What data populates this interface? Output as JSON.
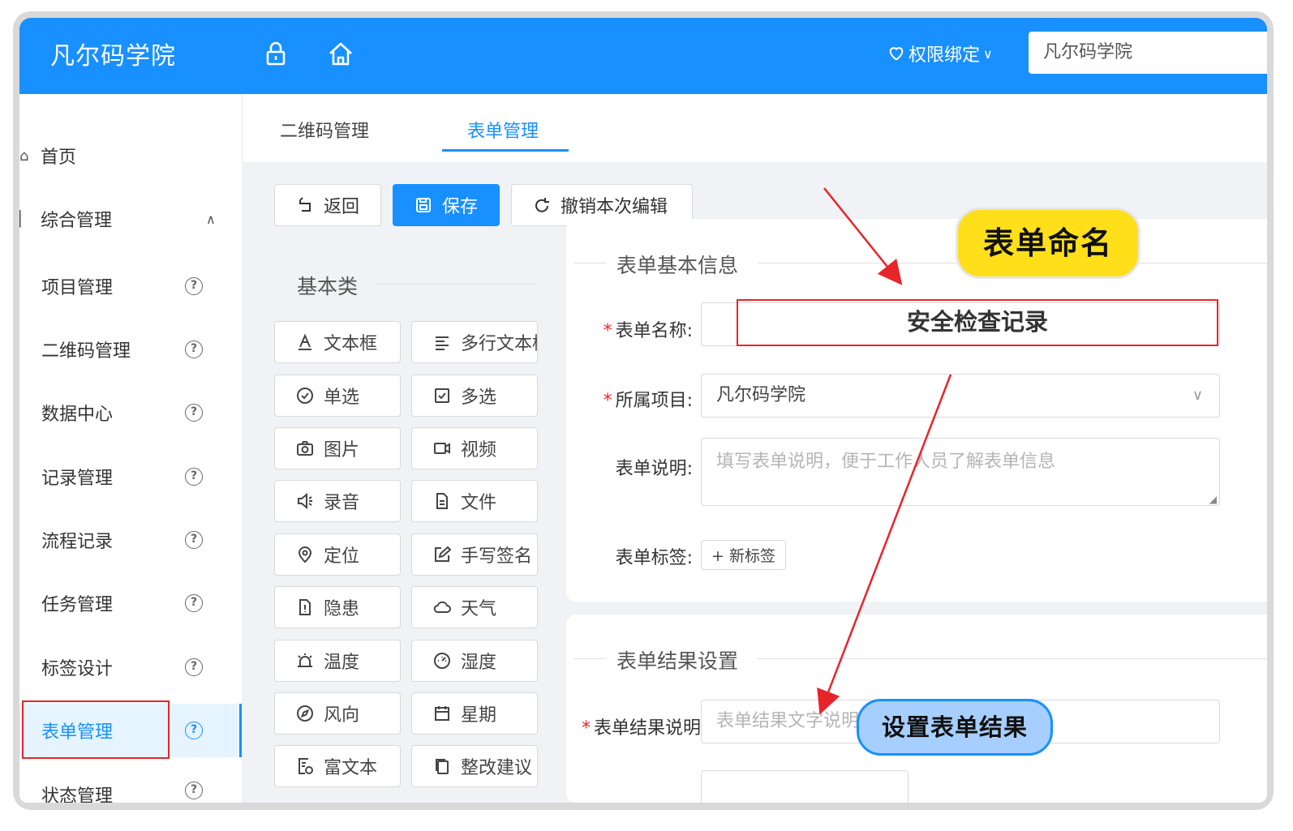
{
  "header": {
    "brand": "凡尔码学院",
    "permission": "权限绑定",
    "search_value": "凡尔码学院"
  },
  "sidebar": {
    "home": "首页",
    "group": "综合管理",
    "items": [
      "项目管理",
      "二维码管理",
      "数据中心",
      "记录管理",
      "流程记录",
      "任务管理",
      "标签设计",
      "表单管理",
      "状态管理"
    ],
    "active_index": 7
  },
  "tabs": [
    "二维码管理",
    "表单管理"
  ],
  "toolbar": {
    "back": "返回",
    "save": "保存",
    "undo": "撤销本次编辑"
  },
  "palette": {
    "section": "基本类",
    "components": [
      {
        "label": "文本框",
        "icon": "text-a-icon"
      },
      {
        "label": "多行文本框",
        "icon": "align-left-icon"
      },
      {
        "label": "单选",
        "icon": "radio-check-icon"
      },
      {
        "label": "多选",
        "icon": "checkbox-icon"
      },
      {
        "label": "图片",
        "icon": "camera-icon"
      },
      {
        "label": "视频",
        "icon": "video-icon"
      },
      {
        "label": "录音",
        "icon": "speaker-icon"
      },
      {
        "label": "文件",
        "icon": "file-icon"
      },
      {
        "label": "定位",
        "icon": "location-icon"
      },
      {
        "label": "手写签名",
        "icon": "edit-icon"
      },
      {
        "label": "隐患",
        "icon": "hazard-file-icon"
      },
      {
        "label": "天气",
        "icon": "cloud-icon"
      },
      {
        "label": "温度",
        "icon": "alarm-icon"
      },
      {
        "label": "湿度",
        "icon": "dashboard-icon"
      },
      {
        "label": "风向",
        "icon": "compass-icon"
      },
      {
        "label": "星期",
        "icon": "calendar-icon"
      },
      {
        "label": "富文本",
        "icon": "rich-text-icon"
      },
      {
        "label": "整改建议",
        "icon": "copy-icon"
      }
    ]
  },
  "form_basic": {
    "section": "表单基本信息",
    "name_label": "表单名称:",
    "name_value": "安全检查记录",
    "project_label": "所属项目:",
    "project_value": "凡尔码学院",
    "desc_label": "表单说明:",
    "desc_placeholder": "填写表单说明，便于工作人员了解表单信息",
    "tag_label": "表单标签:",
    "tag_button": "+ 新标签"
  },
  "form_result": {
    "section": "表单结果设置",
    "result_label": "表单结果说明",
    "result_placeholder": "表单结果文字说明"
  },
  "annotations": {
    "name_callout": "表单命名",
    "result_callout": "设置表单结果"
  },
  "colors": {
    "primary": "#1890ff",
    "annotation_red": "#e8242b",
    "callout_yellow": "#ffdf1a",
    "callout_blue": "#a6cfff"
  }
}
